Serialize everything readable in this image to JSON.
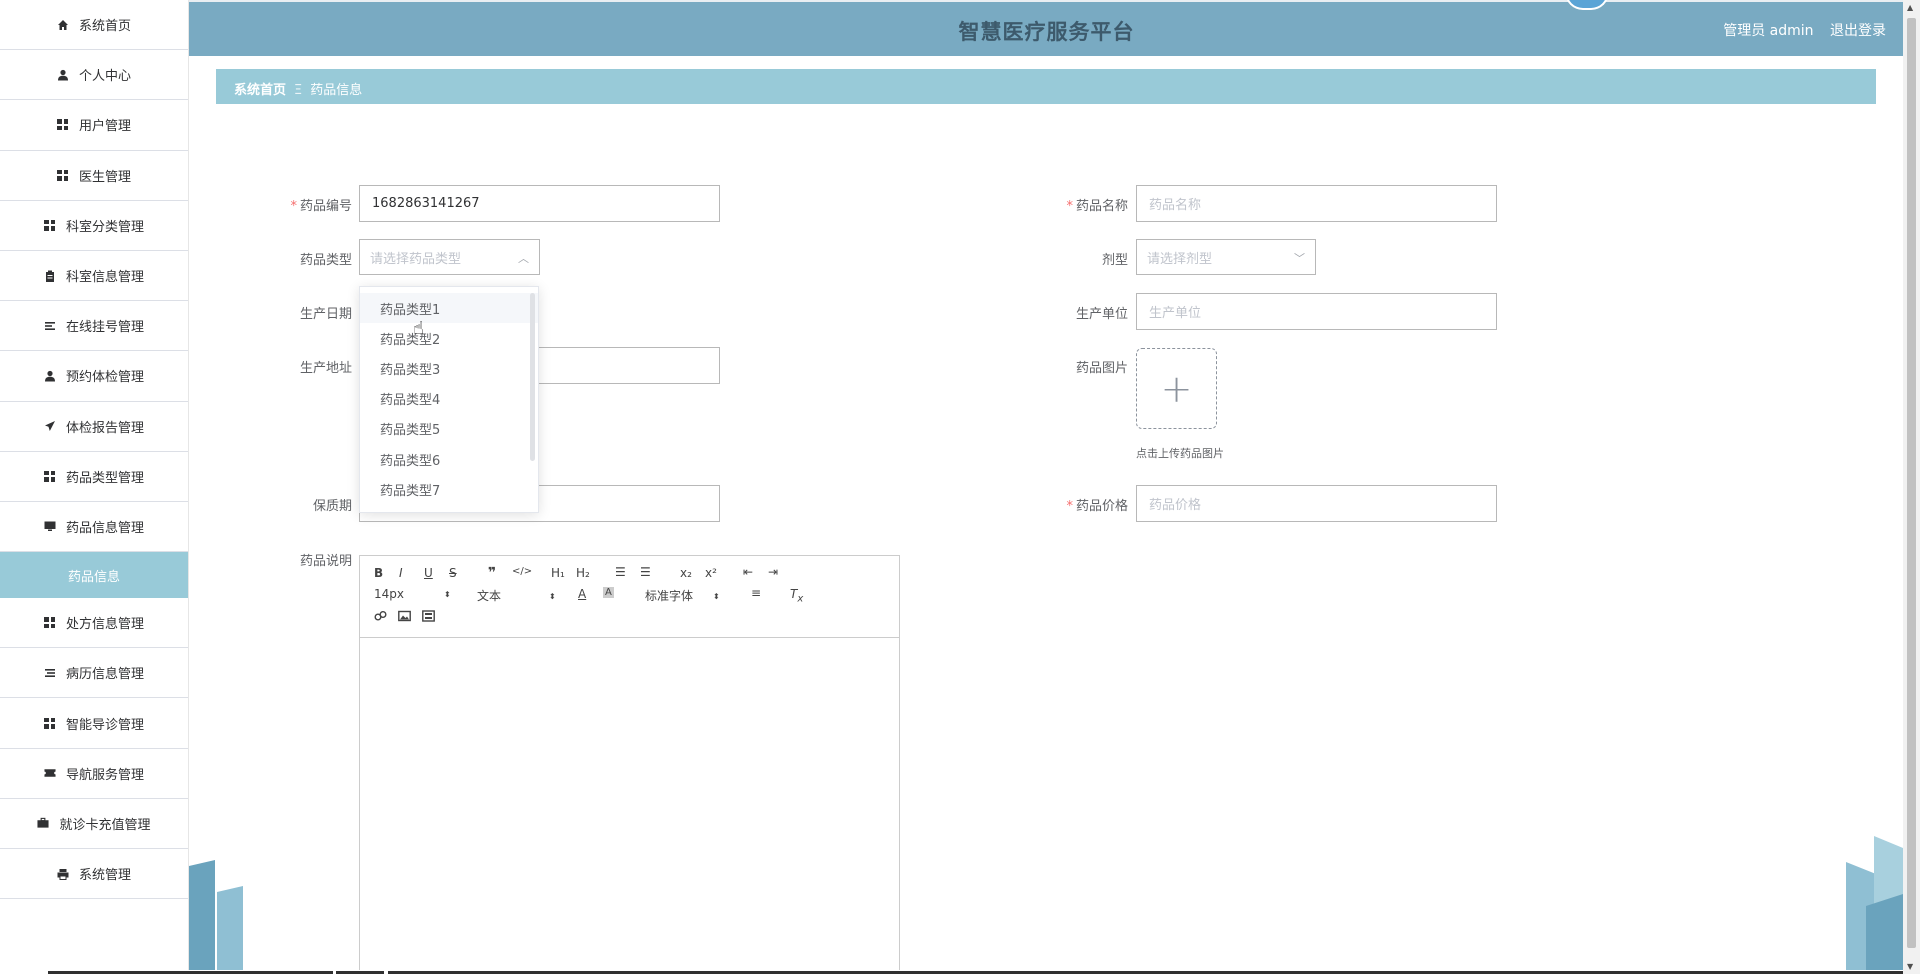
{
  "app": {
    "title": "智慧医疗服务平台",
    "user_label": "管理员 admin",
    "logout_label": "退出登录"
  },
  "sidebar": {
    "items": [
      {
        "label": "系统首页",
        "icon": "home-icon"
      },
      {
        "label": "个人中心",
        "icon": "user-icon"
      },
      {
        "label": "用户管理",
        "icon": "grid-icon"
      },
      {
        "label": "医生管理",
        "icon": "grid-icon"
      },
      {
        "label": "科室分类管理",
        "icon": "grid-icon"
      },
      {
        "label": "科室信息管理",
        "icon": "clipboard-icon"
      },
      {
        "label": "在线挂号管理",
        "icon": "list-icon"
      },
      {
        "label": "预约体检管理",
        "icon": "user-icon"
      },
      {
        "label": "体检报告管理",
        "icon": "send-icon"
      },
      {
        "label": "药品类型管理",
        "icon": "grid-icon"
      },
      {
        "label": "药品信息管理",
        "icon": "monitor-icon"
      },
      {
        "label": "药品信息",
        "icon": "",
        "active": true
      },
      {
        "label": "处方信息管理",
        "icon": "grid-icon"
      },
      {
        "label": "病历信息管理",
        "icon": "list-icon"
      },
      {
        "label": "智能导诊管理",
        "icon": "grid-icon"
      },
      {
        "label": "导航服务管理",
        "icon": "ticket-icon"
      },
      {
        "label": "就诊卡充值管理",
        "icon": "briefcase-icon"
      },
      {
        "label": "系统管理",
        "icon": "printer-icon"
      }
    ]
  },
  "breadcrumb": {
    "home": "系统首页",
    "separator": "Ξ",
    "current": "药品信息"
  },
  "form": {
    "drug_code": {
      "label": "药品编号",
      "value": "1682863141267",
      "required": true
    },
    "drug_name": {
      "label": "药品名称",
      "placeholder": "药品名称",
      "required": true
    },
    "drug_type": {
      "label": "药品类型",
      "placeholder": "请选择药品类型"
    },
    "dosage_form": {
      "label": "剂型",
      "placeholder": "请选择剂型"
    },
    "production_date": {
      "label": "生产日期"
    },
    "manufacturer": {
      "label": "生产单位",
      "placeholder": "生产单位"
    },
    "production_address": {
      "label": "生产地址"
    },
    "drug_image": {
      "label": "药品图片",
      "tip": "点击上传药品图片"
    },
    "shelf_life": {
      "label": "保质期"
    },
    "drug_price": {
      "label": "药品价格",
      "placeholder": "药品价格",
      "required": true
    },
    "drug_description": {
      "label": "药品说明"
    }
  },
  "dropdown": {
    "options": [
      "药品类型1",
      "药品类型2",
      "药品类型3",
      "药品类型4",
      "药品类型5",
      "药品类型6",
      "药品类型7"
    ]
  },
  "editor": {
    "font_size": "14px",
    "header_select": "文本",
    "font_family": "标准字体",
    "h1": "H₁",
    "h2": "H₂"
  },
  "colors": {
    "header_bg": "#79aac2",
    "crumb_bg": "#98cad8",
    "active_menu_bg": "#98cad8",
    "required": "#f56c6c"
  }
}
